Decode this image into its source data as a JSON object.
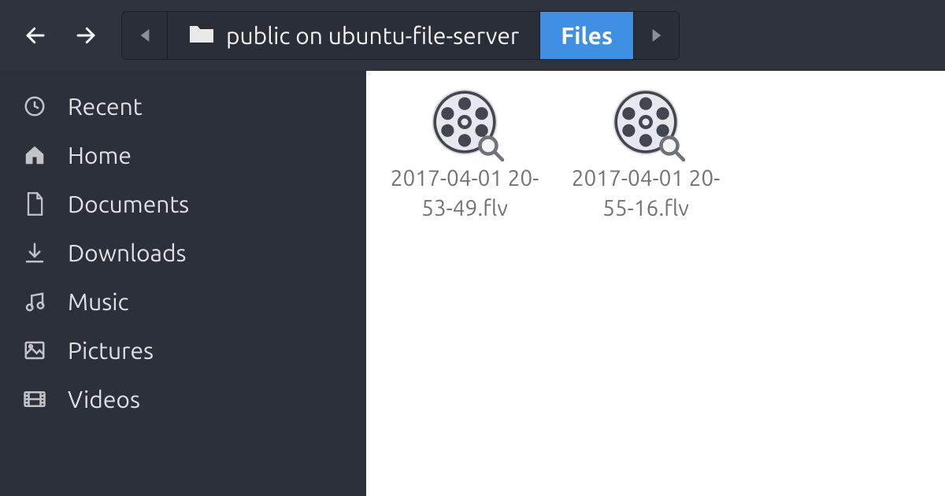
{
  "toolbar": {
    "path_segments": [
      {
        "label": "public on ubuntu-file-server",
        "active": false
      },
      {
        "label": "Files",
        "active": true
      }
    ]
  },
  "sidebar": {
    "items": [
      {
        "icon": "clock-icon",
        "label": "Recent"
      },
      {
        "icon": "home-icon",
        "label": "Home"
      },
      {
        "icon": "document-icon",
        "label": "Documents"
      },
      {
        "icon": "download-icon",
        "label": "Downloads"
      },
      {
        "icon": "music-icon",
        "label": "Music"
      },
      {
        "icon": "picture-icon",
        "label": "Pictures"
      },
      {
        "icon": "video-icon",
        "label": "Videos"
      }
    ]
  },
  "files": [
    {
      "name": "2017-04-01 20-53-49.flv",
      "type": "video"
    },
    {
      "name": "2017-04-01 20-55-16.flv",
      "type": "video"
    }
  ]
}
